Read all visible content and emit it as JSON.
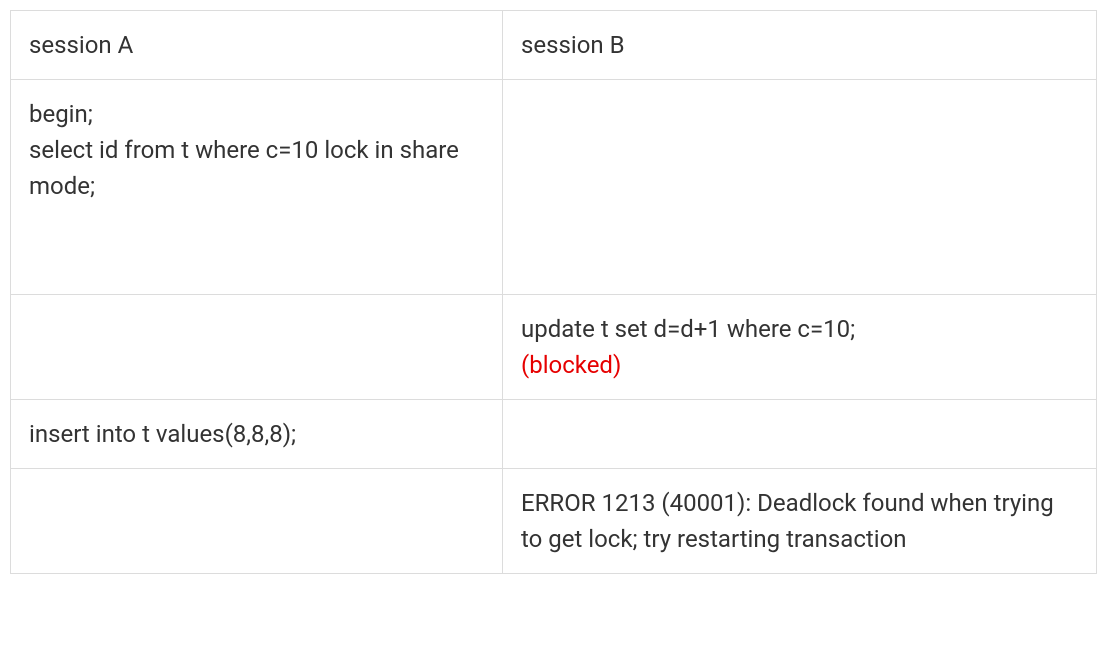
{
  "headers": {
    "col_a": "session A",
    "col_b": "session B"
  },
  "rows": [
    {
      "a_lines": [
        "begin;",
        "select id from t where c=10 lock in share mode;"
      ],
      "b_lines": [],
      "tall": true
    },
    {
      "a_lines": [],
      "b_parts": [
        {
          "text": "update t set d=d+1 where c=10;",
          "highlight": false
        },
        {
          "text": "(blocked)",
          "highlight": true
        }
      ]
    },
    {
      "a_lines": [
        "insert into t values(8,8,8);"
      ],
      "b_lines": []
    },
    {
      "a_lines": [],
      "b_lines": [
        "ERROR 1213 (40001): Deadlock found when trying to get lock; try restarting transaction"
      ]
    }
  ]
}
